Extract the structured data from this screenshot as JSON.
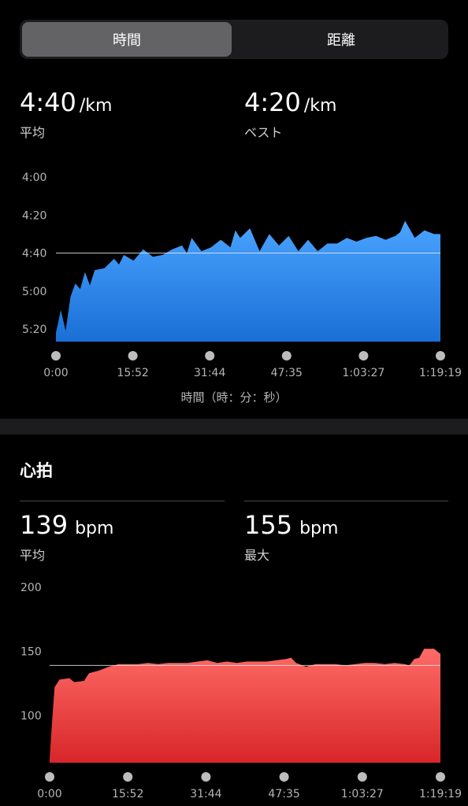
{
  "segmented_control": {
    "options": [
      "時間",
      "距離"
    ],
    "selected": "時間"
  },
  "pace": {
    "average": {
      "value": "4:40",
      "unit": "/km",
      "label": "平均"
    },
    "best": {
      "value": "4:20",
      "unit": "/km",
      "label": "ベスト"
    }
  },
  "heart_rate": {
    "section_title": "心拍",
    "average": {
      "value": "139",
      "unit": "bpm",
      "label": "平均"
    },
    "max": {
      "value": "155",
      "unit": "bpm",
      "label": "最大"
    }
  },
  "colors": {
    "pace_top": "#4aa4ff",
    "pace_bottom": "#1a6fd6",
    "hr_top": "#ff6b66",
    "hr_bottom": "#d8262a"
  },
  "chart_data": [
    {
      "type": "area",
      "x_tick_labels": [
        "0:00",
        "15:52",
        "31:44",
        "47:35",
        "1:03:27",
        "1:19:19"
      ],
      "y_tick_labels": [
        "4:00",
        "4:20",
        "4:40",
        "5:00",
        "5:20"
      ],
      "x_axis_title": "時間（時：分：秒）",
      "ylim_sec_per_km": [
        240,
        328
      ],
      "y_reversed": true,
      "reference_line": 280,
      "x_minutes": [
        0,
        1,
        2,
        3,
        4,
        5,
        6,
        7,
        8,
        10,
        12,
        13,
        14,
        16,
        18,
        20,
        22,
        24,
        26,
        27,
        28,
        30,
        32,
        34,
        36,
        37,
        38,
        40,
        42,
        44,
        46,
        48,
        50,
        52,
        54,
        56,
        58,
        60,
        62,
        64,
        66,
        68,
        70,
        71,
        72,
        74,
        76,
        78,
        79.3
      ],
      "y_sec_per_km": [
        322,
        310,
        321,
        303,
        296,
        299,
        290,
        297,
        289,
        288,
        283,
        286,
        281,
        284,
        278,
        282,
        281,
        278,
        276,
        280,
        272,
        279,
        277,
        273,
        277,
        268,
        272,
        267,
        279,
        270,
        276,
        271,
        279,
        273,
        279,
        275,
        275,
        272,
        274,
        272,
        271,
        273,
        271,
        269,
        263,
        272,
        268,
        270,
        270
      ]
    },
    {
      "type": "area",
      "x_tick_labels": [
        "0:00",
        "15:52",
        "31:44",
        "47:35",
        "1:03:27",
        "1:19:19"
      ],
      "y_tick_labels": [
        "200",
        "150",
        "100"
      ],
      "ylim_bpm": [
        63,
        208
      ],
      "reference_line": 139,
      "x_minutes": [
        0,
        0.5,
        1,
        2,
        4,
        5,
        7,
        8,
        10,
        12,
        14,
        16,
        18,
        20,
        22,
        24,
        26,
        28,
        30,
        32,
        34,
        36,
        38,
        40,
        42,
        44,
        46,
        48,
        49,
        50,
        52,
        54,
        56,
        58,
        60,
        62,
        64,
        66,
        68,
        70,
        72,
        73,
        74,
        75,
        76,
        78,
        79.3
      ],
      "y_bpm": [
        66,
        95,
        122,
        128,
        129,
        126,
        127,
        133,
        135,
        138,
        140,
        140,
        140,
        141,
        140,
        141,
        141,
        141,
        142,
        143,
        141,
        142,
        141,
        142,
        142,
        142,
        143,
        144,
        145,
        141,
        138,
        140,
        140,
        140,
        139,
        140,
        141,
        141,
        140,
        141,
        140,
        139,
        144,
        145,
        152,
        152,
        148
      ]
    }
  ]
}
